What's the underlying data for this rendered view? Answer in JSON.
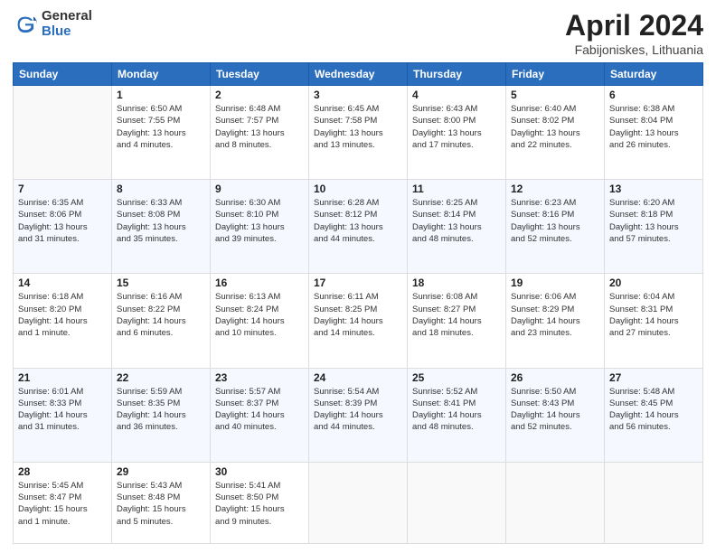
{
  "logo": {
    "text_general": "General",
    "text_blue": "Blue"
  },
  "header": {
    "month_year": "April 2024",
    "location": "Fabijoniskes, Lithuania"
  },
  "columns": [
    "Sunday",
    "Monday",
    "Tuesday",
    "Wednesday",
    "Thursday",
    "Friday",
    "Saturday"
  ],
  "weeks": [
    [
      {
        "day": "",
        "content": ""
      },
      {
        "day": "1",
        "content": "Sunrise: 6:50 AM\nSunset: 7:55 PM\nDaylight: 13 hours\nand 4 minutes."
      },
      {
        "day": "2",
        "content": "Sunrise: 6:48 AM\nSunset: 7:57 PM\nDaylight: 13 hours\nand 8 minutes."
      },
      {
        "day": "3",
        "content": "Sunrise: 6:45 AM\nSunset: 7:58 PM\nDaylight: 13 hours\nand 13 minutes."
      },
      {
        "day": "4",
        "content": "Sunrise: 6:43 AM\nSunset: 8:00 PM\nDaylight: 13 hours\nand 17 minutes."
      },
      {
        "day": "5",
        "content": "Sunrise: 6:40 AM\nSunset: 8:02 PM\nDaylight: 13 hours\nand 22 minutes."
      },
      {
        "day": "6",
        "content": "Sunrise: 6:38 AM\nSunset: 8:04 PM\nDaylight: 13 hours\nand 26 minutes."
      }
    ],
    [
      {
        "day": "7",
        "content": "Sunrise: 6:35 AM\nSunset: 8:06 PM\nDaylight: 13 hours\nand 31 minutes."
      },
      {
        "day": "8",
        "content": "Sunrise: 6:33 AM\nSunset: 8:08 PM\nDaylight: 13 hours\nand 35 minutes."
      },
      {
        "day": "9",
        "content": "Sunrise: 6:30 AM\nSunset: 8:10 PM\nDaylight: 13 hours\nand 39 minutes."
      },
      {
        "day": "10",
        "content": "Sunrise: 6:28 AM\nSunset: 8:12 PM\nDaylight: 13 hours\nand 44 minutes."
      },
      {
        "day": "11",
        "content": "Sunrise: 6:25 AM\nSunset: 8:14 PM\nDaylight: 13 hours\nand 48 minutes."
      },
      {
        "day": "12",
        "content": "Sunrise: 6:23 AM\nSunset: 8:16 PM\nDaylight: 13 hours\nand 52 minutes."
      },
      {
        "day": "13",
        "content": "Sunrise: 6:20 AM\nSunset: 8:18 PM\nDaylight: 13 hours\nand 57 minutes."
      }
    ],
    [
      {
        "day": "14",
        "content": "Sunrise: 6:18 AM\nSunset: 8:20 PM\nDaylight: 14 hours\nand 1 minute."
      },
      {
        "day": "15",
        "content": "Sunrise: 6:16 AM\nSunset: 8:22 PM\nDaylight: 14 hours\nand 6 minutes."
      },
      {
        "day": "16",
        "content": "Sunrise: 6:13 AM\nSunset: 8:24 PM\nDaylight: 14 hours\nand 10 minutes."
      },
      {
        "day": "17",
        "content": "Sunrise: 6:11 AM\nSunset: 8:25 PM\nDaylight: 14 hours\nand 14 minutes."
      },
      {
        "day": "18",
        "content": "Sunrise: 6:08 AM\nSunset: 8:27 PM\nDaylight: 14 hours\nand 18 minutes."
      },
      {
        "day": "19",
        "content": "Sunrise: 6:06 AM\nSunset: 8:29 PM\nDaylight: 14 hours\nand 23 minutes."
      },
      {
        "day": "20",
        "content": "Sunrise: 6:04 AM\nSunset: 8:31 PM\nDaylight: 14 hours\nand 27 minutes."
      }
    ],
    [
      {
        "day": "21",
        "content": "Sunrise: 6:01 AM\nSunset: 8:33 PM\nDaylight: 14 hours\nand 31 minutes."
      },
      {
        "day": "22",
        "content": "Sunrise: 5:59 AM\nSunset: 8:35 PM\nDaylight: 14 hours\nand 36 minutes."
      },
      {
        "day": "23",
        "content": "Sunrise: 5:57 AM\nSunset: 8:37 PM\nDaylight: 14 hours\nand 40 minutes."
      },
      {
        "day": "24",
        "content": "Sunrise: 5:54 AM\nSunset: 8:39 PM\nDaylight: 14 hours\nand 44 minutes."
      },
      {
        "day": "25",
        "content": "Sunrise: 5:52 AM\nSunset: 8:41 PM\nDaylight: 14 hours\nand 48 minutes."
      },
      {
        "day": "26",
        "content": "Sunrise: 5:50 AM\nSunset: 8:43 PM\nDaylight: 14 hours\nand 52 minutes."
      },
      {
        "day": "27",
        "content": "Sunrise: 5:48 AM\nSunset: 8:45 PM\nDaylight: 14 hours\nand 56 minutes."
      }
    ],
    [
      {
        "day": "28",
        "content": "Sunrise: 5:45 AM\nSunset: 8:47 PM\nDaylight: 15 hours\nand 1 minute."
      },
      {
        "day": "29",
        "content": "Sunrise: 5:43 AM\nSunset: 8:48 PM\nDaylight: 15 hours\nand 5 minutes."
      },
      {
        "day": "30",
        "content": "Sunrise: 5:41 AM\nSunset: 8:50 PM\nDaylight: 15 hours\nand 9 minutes."
      },
      {
        "day": "",
        "content": ""
      },
      {
        "day": "",
        "content": ""
      },
      {
        "day": "",
        "content": ""
      },
      {
        "day": "",
        "content": ""
      }
    ]
  ]
}
